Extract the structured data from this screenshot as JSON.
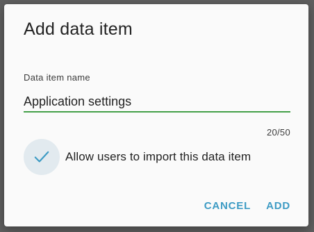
{
  "dialog": {
    "title": "Add data item",
    "field": {
      "label": "Data item name",
      "value": "Application settings",
      "counter": "20/50"
    },
    "checkbox": {
      "label": "Allow users to import this data item",
      "checked": true,
      "icon": "check-icon"
    },
    "buttons": {
      "cancel": "CANCEL",
      "add": "ADD"
    }
  },
  "colors": {
    "accent": "#3d9bc4",
    "underline": "#43a047",
    "check_bg": "#e2eaef",
    "backdrop": "#5f5f5f"
  }
}
